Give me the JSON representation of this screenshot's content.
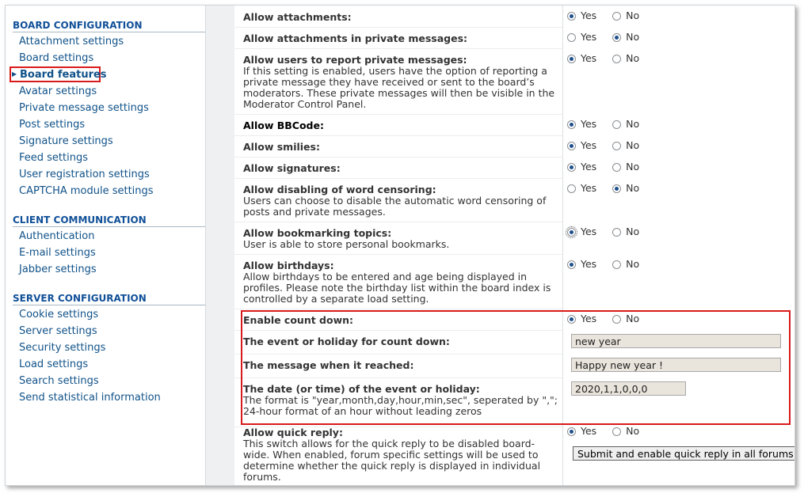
{
  "sidebar": {
    "board_configuration": {
      "heading": "BOARD CONFIGURATION",
      "items": [
        "Attachment settings",
        "Board settings",
        "Board features",
        "Avatar settings",
        "Private message settings",
        "Post settings",
        "Signature settings",
        "Feed settings",
        "User registration settings",
        "CAPTCHA module settings"
      ],
      "active_index": 2
    },
    "client_communication": {
      "heading": "CLIENT COMMUNICATION",
      "items": [
        "Authentication",
        "E-mail settings",
        "Jabber settings"
      ]
    },
    "server_configuration": {
      "heading": "SERVER CONFIGURATION",
      "items": [
        "Cookie settings",
        "Server settings",
        "Security settings",
        "Load settings",
        "Search settings",
        "Send statistical information"
      ]
    }
  },
  "radio_labels": {
    "yes": "Yes",
    "no": "No"
  },
  "settings": [
    {
      "title": "Allow attachments:",
      "desc": "",
      "value": "yes"
    },
    {
      "title": "Allow attachments in private messages:",
      "desc": "",
      "value": "no"
    },
    {
      "title": "Allow users to report private messages:",
      "desc": "If this setting is enabled, users have the option of reporting a private message they have received or sent to the board’s moderators. These private messages will then be visible in the Moderator Control Panel.",
      "value": "yes"
    },
    {
      "title": "Allow BBCode:",
      "desc": "",
      "value": "yes"
    },
    {
      "title": "Allow smilies:",
      "desc": "",
      "value": "yes"
    },
    {
      "title": "Allow signatures:",
      "desc": "",
      "value": "yes"
    },
    {
      "title": "Allow disabling of word censoring:",
      "desc": "Users can choose to disable the automatic word censoring of posts and private messages.",
      "value": "no"
    },
    {
      "title": "Allow bookmarking topics:",
      "desc": "User is able to store personal bookmarks.",
      "value": "yes"
    },
    {
      "title": "Allow birthdays:",
      "desc": "Allow birthdays to be entered and age being displayed in profiles. Please note the birthday list within the board index is controlled by a separate load setting.",
      "value": "yes"
    },
    {
      "title": "Enable count down:",
      "desc": "",
      "value": "yes"
    },
    {
      "title": "The event or holiday for count down:",
      "desc": "",
      "input": "new year"
    },
    {
      "title": "The message when it reached:",
      "desc": "",
      "input": "Happy new year !"
    },
    {
      "title": "The date (or time) of the event or holiday:",
      "desc": "The format is \"year,month,day,hour,min,sec\", seperated by \",\"; 24-hour format of an hour without leading zeros",
      "input": "2020,1,1,0,0,0"
    },
    {
      "title": "Allow quick reply:",
      "desc": "This switch allows for the quick reply to be disabled board-wide. When enabled, forum specific settings will be used to determine whether the quick reply is displayed in individual forums.",
      "value": "yes",
      "button": "Submit and enable quick reply in all forums"
    }
  ],
  "colors": {
    "link": "#105289",
    "heading": "#115098",
    "highlight": "#d91a1a",
    "input_bg": "#e9e4dc"
  }
}
